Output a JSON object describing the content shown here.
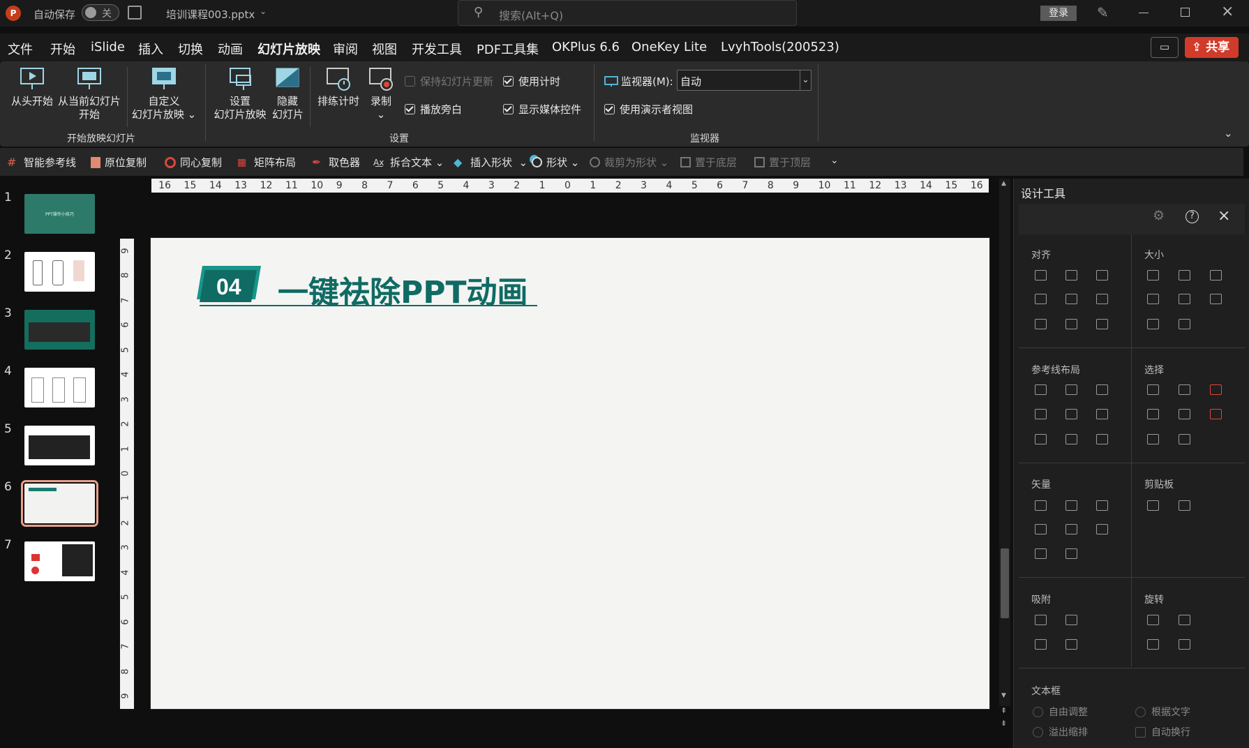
{
  "titlebar": {
    "autosave_label": "自动保存",
    "autosave_state": "关",
    "file_name": "培训课程003.pptx",
    "search_placeholder": "搜索(Alt+Q)",
    "login_label": "登录"
  },
  "menu": {
    "tabs": [
      "文件",
      "开始",
      "iSlide",
      "插入",
      "切换",
      "动画",
      "幻灯片放映",
      "审阅",
      "视图",
      "开发工具",
      "PDF工具集",
      "OKPlus 6.6",
      "OneKey Lite",
      "LvyhTools(200523)"
    ],
    "active_tab": "幻灯片放映",
    "share_label": "共享"
  },
  "ribbon": {
    "from_start": "从头开始",
    "from_current_1": "从当前幻灯片",
    "from_current_2": "开始",
    "custom_1": "自定义",
    "custom_2": "幻灯片放映",
    "group_start": "开始放映幻灯片",
    "setup_1": "设置",
    "setup_2": "幻灯片放映",
    "hide_1": "隐藏",
    "hide_2": "幻灯片",
    "rehearse": "排练计时",
    "record": "录制",
    "keep_updated": "保持幻灯片更新",
    "play_narration": "播放旁白",
    "use_timings": "使用计时",
    "show_media_controls": "显示媒体控件",
    "group_setup": "设置",
    "monitor_label": "监视器(M):",
    "monitor_value": "自动",
    "presenter_view": "使用演示者视图",
    "group_monitor": "监视器"
  },
  "quickbar": {
    "items": [
      "智能参考线",
      "原位复制",
      "同心复制",
      "矩阵布局",
      "取色器",
      "拆合文本",
      "插入形状",
      "形状",
      "裁剪为形状",
      "置于底层",
      "置于顶层"
    ]
  },
  "slides": {
    "numbers": [
      "1",
      "2",
      "3",
      "4",
      "5",
      "6",
      "7"
    ],
    "selected": 6
  },
  "ruler": {
    "h_ticks": [
      "16",
      "15",
      "14",
      "13",
      "12",
      "11",
      "10",
      "9",
      "8",
      "7",
      "6",
      "5",
      "4",
      "3",
      "2",
      "1",
      "0",
      "1",
      "2",
      "3",
      "4",
      "5",
      "6",
      "7",
      "8",
      "9",
      "10",
      "11",
      "12",
      "13",
      "14",
      "15",
      "16"
    ],
    "v_ticks": [
      "9",
      "8",
      "7",
      "6",
      "5",
      "4",
      "3",
      "2",
      "1",
      "0",
      "1",
      "2",
      "3",
      "4",
      "5",
      "6",
      "7",
      "8",
      "9"
    ]
  },
  "slide": {
    "number_badge": "04",
    "heading": "一键祛除PPT动画",
    "accent_color": "#0f6b63"
  },
  "thumb1_text": "PPT操作小技巧",
  "panel": {
    "title": "设计工具",
    "sections": {
      "align": "对齐",
      "size": "大小",
      "guides": "参考线布局",
      "select": "选择",
      "vector": "矢量",
      "clipboard": "剪贴板",
      "snap": "吸附",
      "rotate": "旋转",
      "textbox": "文本框"
    },
    "textbox_options": [
      "自由调整",
      "根据文字",
      "溢出缩排",
      "自动换行"
    ]
  }
}
